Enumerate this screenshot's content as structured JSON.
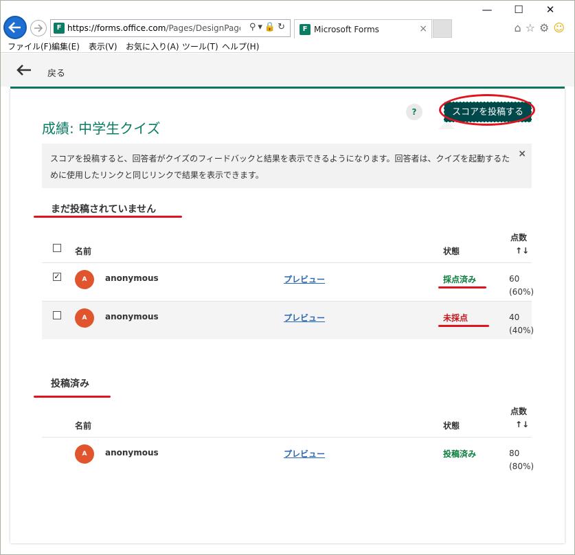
{
  "browser": {
    "url_host": "https://forms.office.com",
    "url_path": "/Pages/DesignPage.aspx",
    "tab_title": "Microsoft Forms",
    "tab_close": "×",
    "favicon": "F",
    "win_min": "—",
    "win_max": "☐",
    "win_close": "✕"
  },
  "menu": [
    "ファイル(F)",
    "編集(E)",
    "表示(V)",
    "お気に入り(A)",
    "ツール(T)",
    "ヘルプ(H)"
  ],
  "toolbar": {
    "back_label": "戻る"
  },
  "page": {
    "title": "成績: 中学生クイズ",
    "help": "?",
    "post_button": "スコアを投稿する",
    "info_text": "スコアを投稿すると、回答者がクイズのフィードバックと結果を表示できるようになります。回答者は、クイズを起動するために使用したリンクと同じリンクで結果を表示できます。",
    "info_close": "×"
  },
  "columns": {
    "name": "名前",
    "status": "状態",
    "score": "点数",
    "sort": "↑↓"
  },
  "unposted": {
    "heading": "まだ投稿されていません",
    "rows": [
      {
        "avatar": "A",
        "name": "anonymous",
        "preview": "プレビュー",
        "status": "採点済み",
        "score": "60",
        "percent": "(60%)",
        "checked": true,
        "check_mark": "✓"
      },
      {
        "avatar": "A",
        "name": "anonymous",
        "preview": "プレビュー",
        "status": "未採点",
        "score": "40",
        "percent": "(40%)",
        "checked": false,
        "check_mark": ""
      }
    ]
  },
  "posted": {
    "heading": "投稿済み",
    "rows": [
      {
        "avatar": "A",
        "name": "anonymous",
        "preview": "プレビュー",
        "status": "投稿済み",
        "score": "80",
        "percent": "(80%)"
      }
    ]
  },
  "colors": {
    "accent": "#0a7d64",
    "graded_status": "#0a7d3c",
    "ungraded_status": "#c4161c",
    "posted_status": "#0a7d3c",
    "annotation": "#e0131e"
  }
}
